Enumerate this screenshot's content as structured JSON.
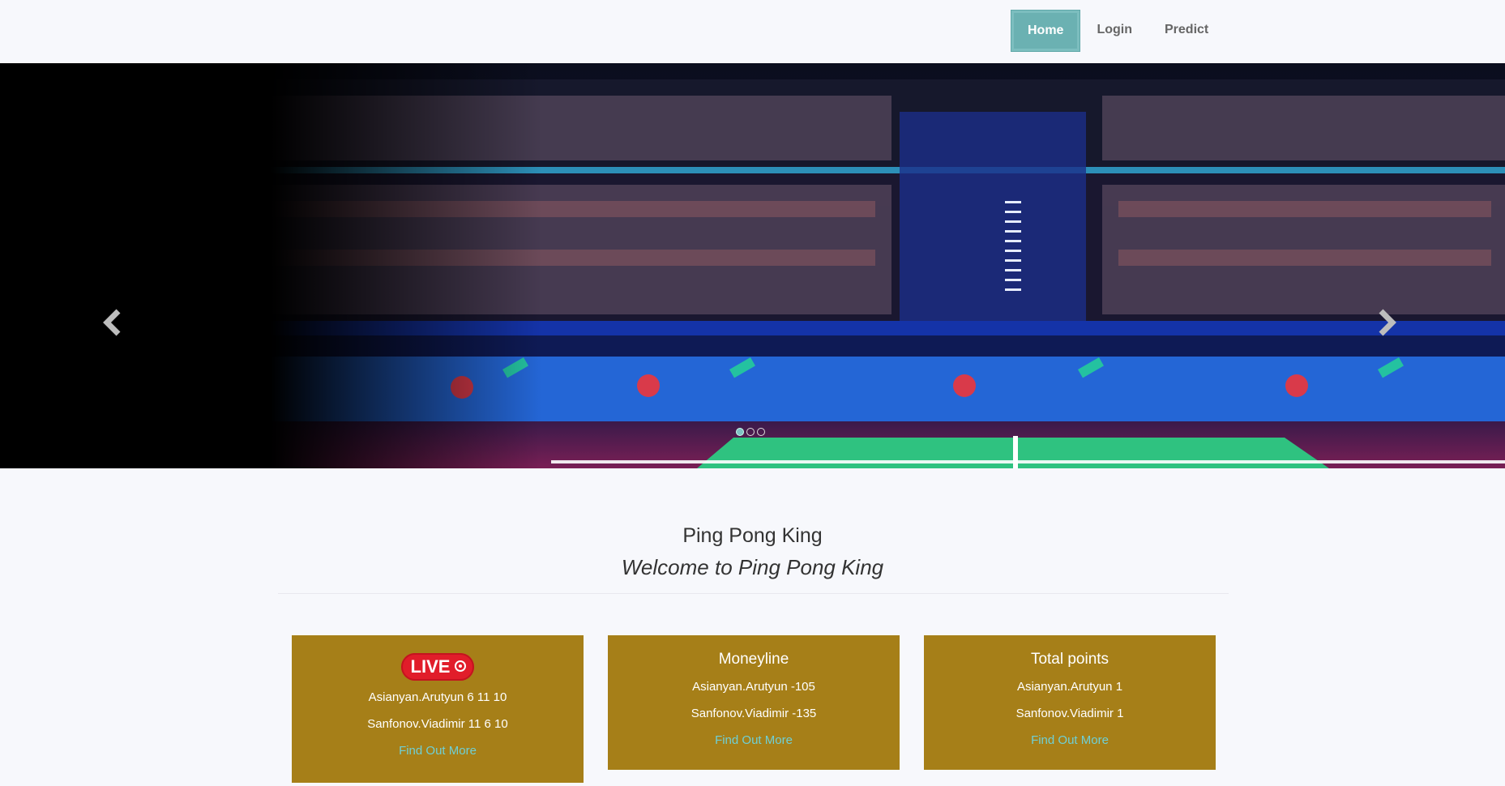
{
  "nav": {
    "items": [
      {
        "label": "Home",
        "active": true
      },
      {
        "label": "Login",
        "active": false
      },
      {
        "label": "Predict",
        "active": false
      }
    ]
  },
  "carousel": {
    "slide_count": 3,
    "active_index": 0,
    "prev_icon": "chevron-left-icon",
    "next_icon": "chevron-right-icon"
  },
  "intro": {
    "title": "Ping Pong King",
    "subtitle": "Welcome to Ping Pong King"
  },
  "cards": {
    "live": {
      "badge": "LIVE",
      "rows": [
        "Asianyan.Arutyun 6 11 10",
        "Sanfonov.Viadimir 11 6 10"
      ],
      "link": "Find Out More"
    },
    "moneyline": {
      "title": "Moneyline",
      "rows": [
        "Asianyan.Arutyun -105",
        "Sanfonov.Viadimir -135"
      ],
      "link": "Find Out More"
    },
    "total": {
      "title": "Total points",
      "rows": [
        "Asianyan.Arutyun 1",
        "Sanfonov.Viadimir 1"
      ],
      "link": "Find Out More"
    }
  },
  "colors": {
    "accent": "#6bb1b2",
    "card_bg": "#a67f18",
    "link": "#6fd0d6",
    "live_red": "#e11d2a",
    "page_bg": "#f7f8fc"
  }
}
